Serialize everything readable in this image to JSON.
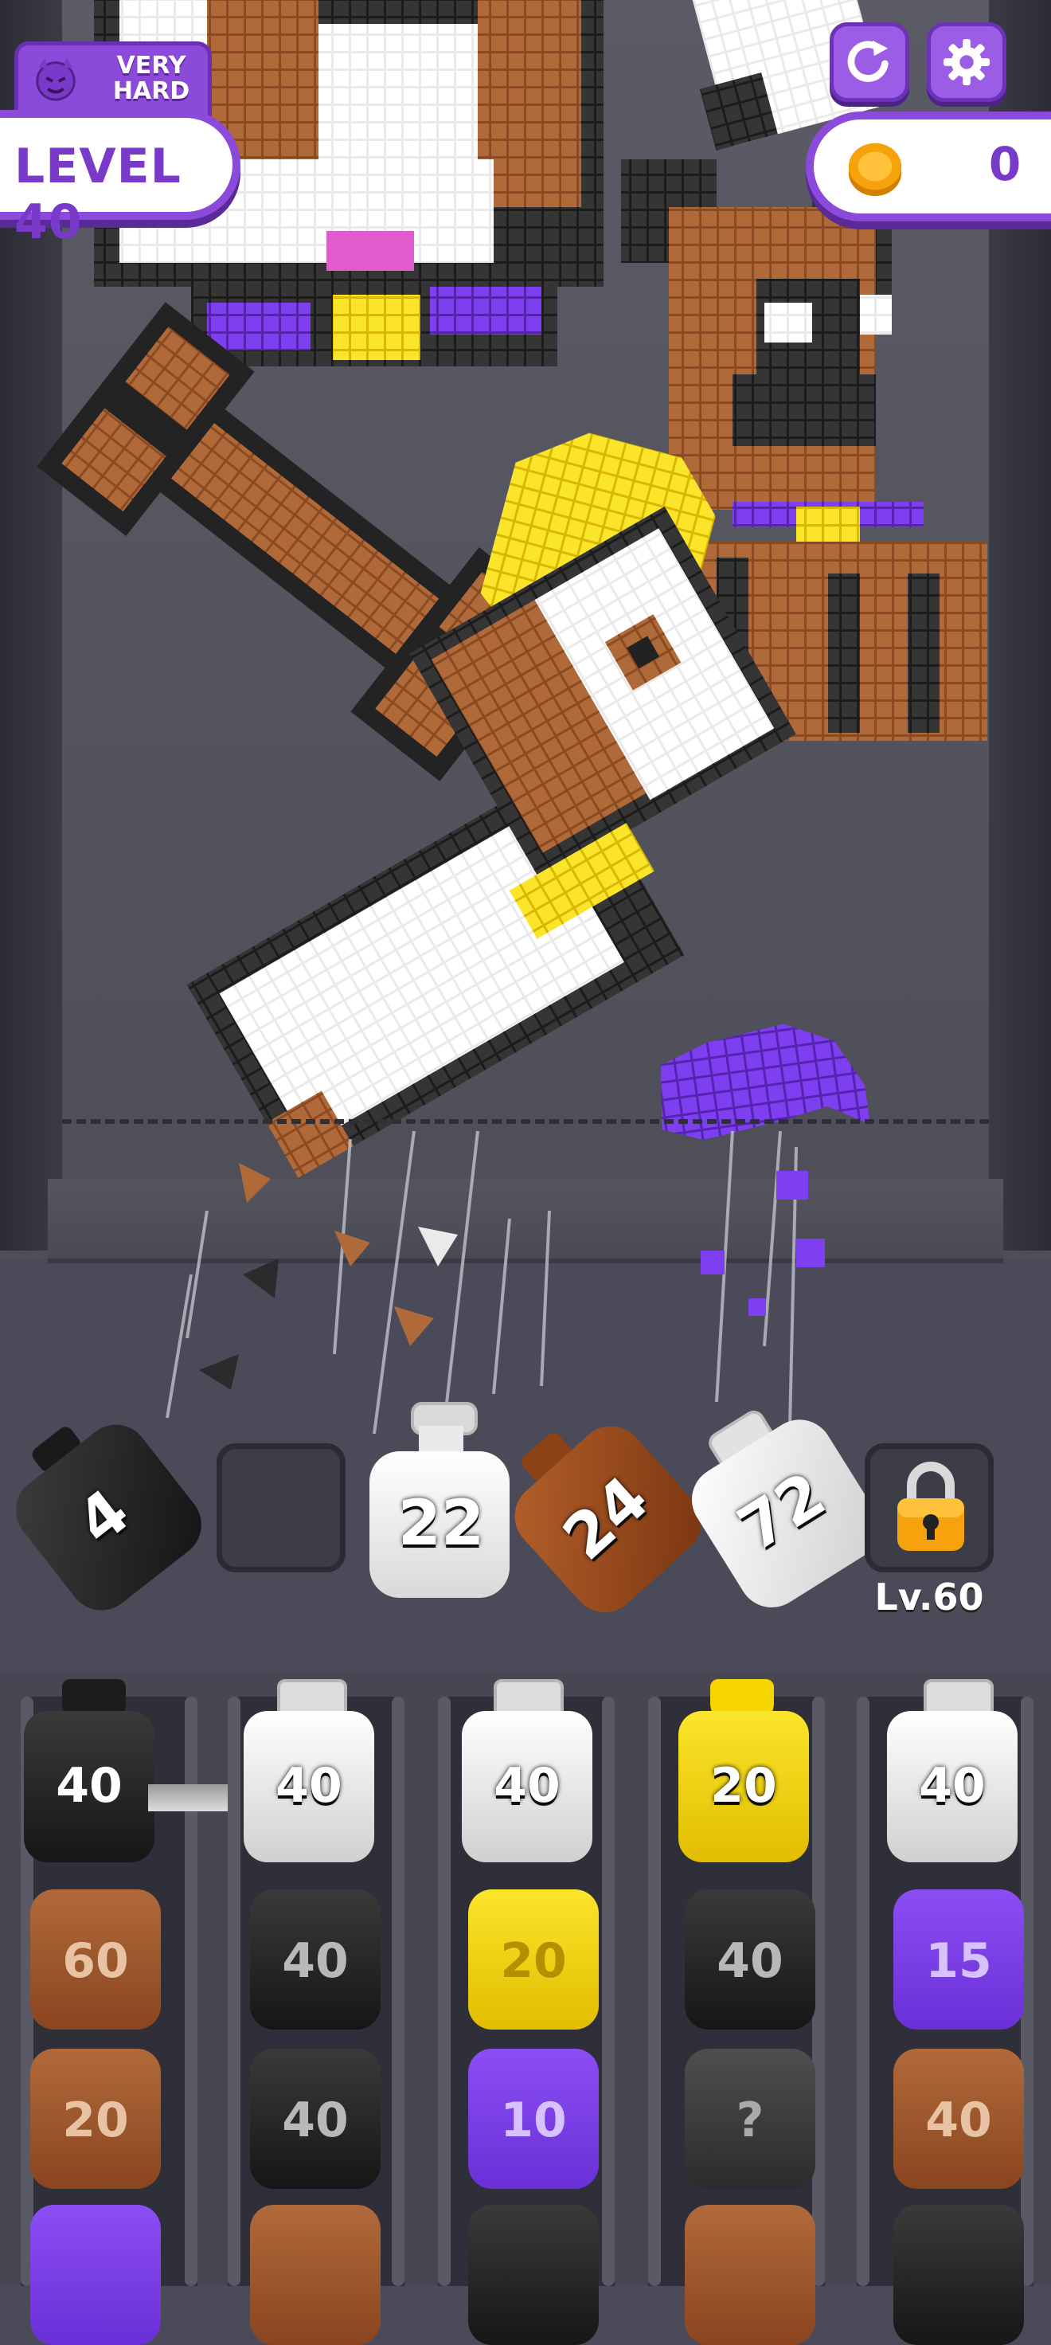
{
  "hud": {
    "difficulty": "VERY HARD",
    "level": "LEVEL 40",
    "coins": "0",
    "colors": {
      "purple": "#8b4ad9",
      "coin": "#f5a20c"
    }
  },
  "icons": {
    "difficulty": "devil-face-icon",
    "restart": "restart-icon",
    "settings": "gear-icon",
    "coin": "coin-icon",
    "lock": "padlock-icon"
  },
  "shooters": [
    {
      "color": "black",
      "count": "4"
    },
    {
      "color": "empty",
      "count": ""
    },
    {
      "color": "white",
      "count": "22"
    },
    {
      "color": "brown",
      "count": "24"
    },
    {
      "color": "white",
      "count": "72"
    },
    {
      "color": "locked",
      "count": ""
    }
  ],
  "locked_slot": {
    "label": "Lv.60"
  },
  "queue": {
    "columns": [
      {
        "top": {
          "color": "black",
          "count": "40"
        },
        "blocks": [
          {
            "color": "brown",
            "count": "60"
          },
          {
            "color": "brown",
            "count": "20"
          },
          {
            "color": "purple",
            "count": ""
          }
        ]
      },
      {
        "top": {
          "color": "white",
          "count": "40"
        },
        "blocks": [
          {
            "color": "black",
            "count": "40"
          },
          {
            "color": "black",
            "count": "40"
          },
          {
            "color": "brown",
            "count": ""
          }
        ]
      },
      {
        "top": {
          "color": "white",
          "count": "40"
        },
        "blocks": [
          {
            "color": "yellow",
            "count": "20"
          },
          {
            "color": "purple",
            "count": "10"
          },
          {
            "color": "black",
            "count": ""
          }
        ]
      },
      {
        "top": {
          "color": "yellow",
          "count": "20"
        },
        "blocks": [
          {
            "color": "black",
            "count": "40"
          },
          {
            "color": "hidden",
            "count": "?"
          },
          {
            "color": "brown",
            "count": ""
          }
        ]
      },
      {
        "top": {
          "color": "white",
          "count": "40"
        },
        "blocks": [
          {
            "color": "purple",
            "count": "15"
          },
          {
            "color": "brown",
            "count": "40"
          },
          {
            "color": "black",
            "count": ""
          }
        ]
      }
    ]
  }
}
